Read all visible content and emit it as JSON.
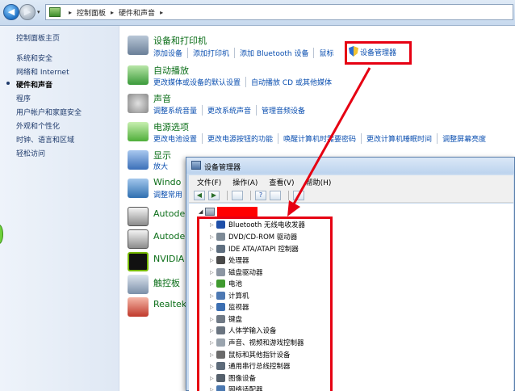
{
  "address": {
    "crumbs": [
      "控制面板",
      "硬件和声音"
    ]
  },
  "sidebar": {
    "items": [
      {
        "label": "控制面板主页",
        "active": false
      },
      {
        "label": "系统和安全",
        "active": false
      },
      {
        "label": "网络和 Internet",
        "active": false
      },
      {
        "label": "硬件和声音",
        "active": true
      },
      {
        "label": "程序",
        "active": false
      },
      {
        "label": "用户帐户和家庭安全",
        "active": false
      },
      {
        "label": "外观和个性化",
        "active": false
      },
      {
        "label": "时钟、语言和区域",
        "active": false
      },
      {
        "label": "轻松访问",
        "active": false
      }
    ]
  },
  "categories": [
    {
      "title": "设备和打印机",
      "links": [
        "添加设备",
        "添加打印机",
        "添加 Bluetooth 设备",
        "鼠标"
      ],
      "icon": "printer-icon",
      "color": "#6a7f98"
    },
    {
      "title": "自动播放",
      "links": [
        "更改媒体或设备的默认设置",
        "自动播放 CD 或其他媒体"
      ],
      "icon": "autoplay-icon",
      "color": "#3a9a3a"
    },
    {
      "title": "声音",
      "links": [
        "调整系统音量",
        "更改系统声音",
        "管理音频设备"
      ],
      "icon": "speaker-icon",
      "color": "#8a8a8a"
    },
    {
      "title": "电源选项",
      "links": [
        "更改电池设置",
        "更改电源按钮的功能",
        "唤醒计算机时需要密码",
        "更改计算机睡眠时间",
        "调整屏幕亮度"
      ],
      "icon": "battery-icon",
      "color": "#4fae3a"
    },
    {
      "title": "显示",
      "links": [
        "放大"
      ],
      "icon": "display-icon",
      "color": "#3b6fb8"
    },
    {
      "title": "Windo",
      "links": [
        "调整常用"
      ],
      "icon": "mobility-icon",
      "color": "#2f6fb0"
    },
    {
      "title": "Autode",
      "links": [],
      "icon": "autodesk-printer-icon",
      "color": "#555555"
    },
    {
      "title": "Autode",
      "links": [],
      "icon": "autodesk-printer-icon",
      "color": "#555555"
    },
    {
      "title": "NVIDIA",
      "links": [],
      "icon": "nvidia-icon",
      "color": "#76b900"
    },
    {
      "title": "触控板",
      "links": [],
      "icon": "touchpad-icon",
      "color": "#7b8fa8"
    },
    {
      "title": "Realtek",
      "links": [],
      "icon": "realtek-icon",
      "color": "#c0392b"
    }
  ],
  "highlight": {
    "label": "设备管理器"
  },
  "device_manager": {
    "title": "设备管理器",
    "menu": [
      "文件(F)",
      "操作(A)",
      "查看(V)",
      "帮助(H)"
    ],
    "devices": [
      {
        "label": "Bluetooth 无线电收发器",
        "color": "#1f4fa8"
      },
      {
        "label": "DVD/CD-ROM 驱动器",
        "color": "#7d8a96"
      },
      {
        "label": "IDE ATA/ATAPI 控制器",
        "color": "#5f6f80"
      },
      {
        "label": "处理器",
        "color": "#4a4a4a"
      },
      {
        "label": "磁盘驱动器",
        "color": "#8c96a3"
      },
      {
        "label": "电池",
        "color": "#3f9a2f"
      },
      {
        "label": "计算机",
        "color": "#4d79b3"
      },
      {
        "label": "监视器",
        "color": "#3c6fb2"
      },
      {
        "label": "键盘",
        "color": "#707a86"
      },
      {
        "label": "人体学输入设备",
        "color": "#6a7480"
      },
      {
        "label": "声音、视频和游戏控制器",
        "color": "#9aa4ae"
      },
      {
        "label": "鼠标和其他指针设备",
        "color": "#6b6b6b"
      },
      {
        "label": "通用串行总线控制器",
        "color": "#5d6b7a"
      },
      {
        "label": "图像设备",
        "color": "#55606c"
      },
      {
        "label": "网络适配器",
        "color": "#4b78b0"
      }
    ]
  },
  "colors": {
    "annotation_red": "#e60012"
  }
}
